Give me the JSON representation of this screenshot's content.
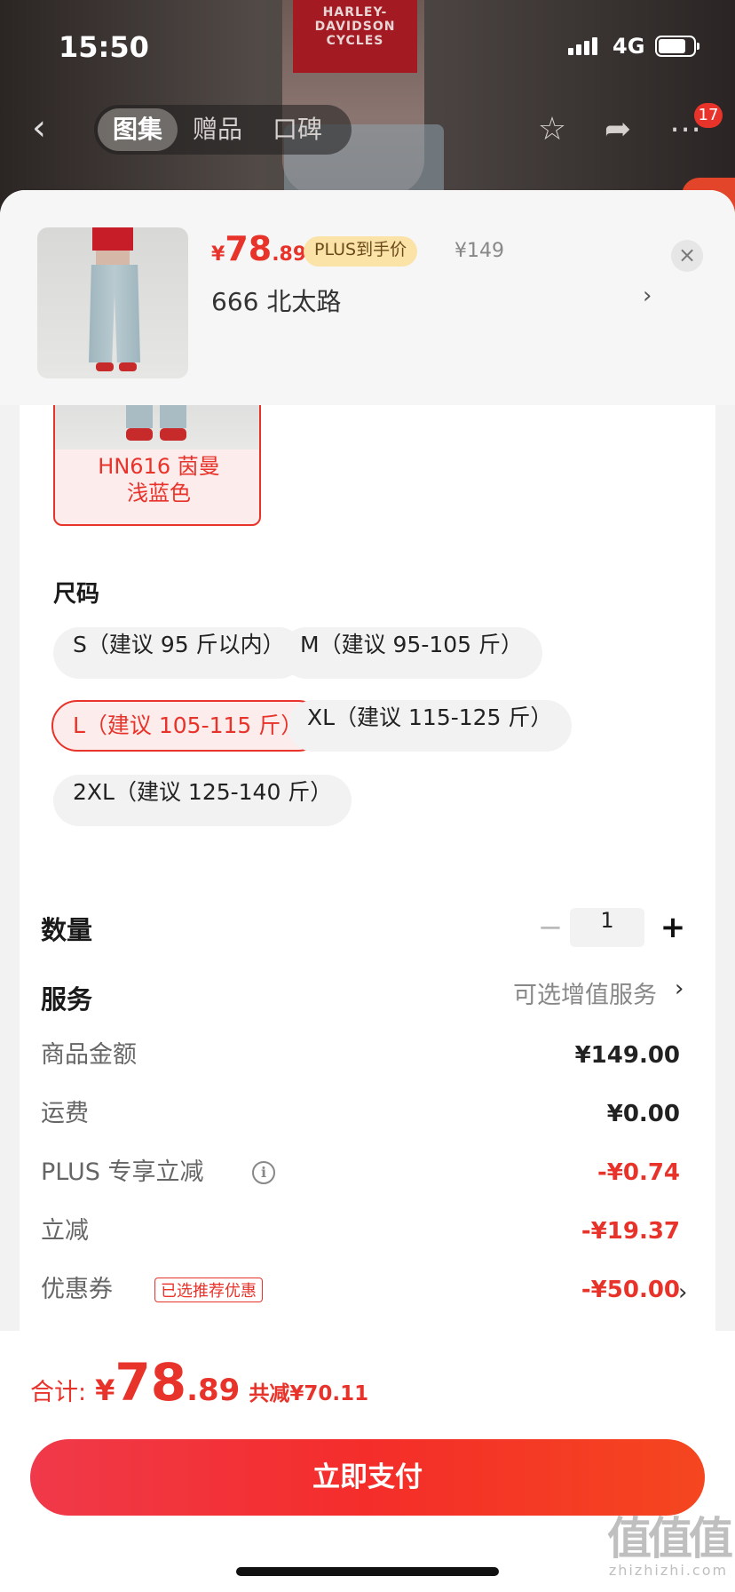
{
  "status_bar": {
    "time": "15:50",
    "network": "4G"
  },
  "nav": {
    "back": "‹",
    "tabs": [
      {
        "label": "图集",
        "active": true
      },
      {
        "label": "赠品",
        "active": false
      },
      {
        "label": "口碑",
        "active": false
      }
    ],
    "icons": [
      "star-icon",
      "share-icon",
      "more-icon"
    ],
    "badge": "17"
  },
  "backdrop": {
    "shirt_text": "HARLEY-DAVIDSON CYCLES"
  },
  "product": {
    "price_yen": "¥",
    "price_int": "78",
    "price_dec": ".89",
    "plus_tag": "PLUS到手价",
    "original_price": "¥149",
    "variant": "666  北太路",
    "variant_chevron": "›",
    "close": "×"
  },
  "color_option": {
    "name_line1": "HN616  茵曼",
    "name_line2": "浅蓝色",
    "selected": true
  },
  "sizes": {
    "label": "尺码",
    "options": [
      {
        "label": "S（建议 95 斤以内）",
        "selected": false
      },
      {
        "label": "M（建议 95-105 斤）",
        "selected": false
      },
      {
        "label": "L（建议 105-115 斤）",
        "selected": true
      },
      {
        "label": "XL（建议 115-125 斤）",
        "selected": false
      },
      {
        "label": "2XL（建议 125-140 斤）",
        "selected": false
      }
    ]
  },
  "quantity": {
    "label": "数量",
    "minus": "−",
    "value": "1",
    "plus": "+"
  },
  "service": {
    "label": "服务",
    "value": "可选增值服务",
    "chevron": "›"
  },
  "summary": {
    "rows": [
      {
        "label": "商品金额",
        "value": "¥149.00"
      },
      {
        "label": "运费",
        "value": "¥0.00"
      },
      {
        "label": "PLUS 专享立减",
        "value": "-¥0.74",
        "info_icon": "i"
      },
      {
        "label": "立减",
        "value": "-¥19.37"
      },
      {
        "label": "优惠券",
        "value": "-¥50.00",
        "tag": "已选推荐优惠",
        "chevron": "›"
      }
    ]
  },
  "footer": {
    "total_label": "合计:",
    "total_yen": "¥",
    "total_int": "78",
    "total_dec": ".89",
    "saved": "共减¥70.11",
    "pay_button": "立即支付"
  },
  "watermark": {
    "big": "值值值",
    "small": "zhizhizhi.com"
  },
  "colors": {
    "accent": "#e8332b",
    "plus_tag_bg": "#fbe3a8",
    "sheet_bg": "#f2f2f2"
  }
}
